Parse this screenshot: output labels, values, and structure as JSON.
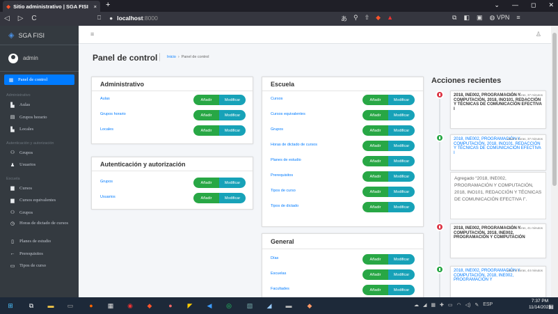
{
  "browser": {
    "tab_title": "Sitio administrativo | SGA FISI",
    "tab_close": "×",
    "new_tab": "+",
    "url_host": "localhost",
    "url_port": ":8000",
    "vpn_label": "VPN",
    "win_min": "—",
    "win_max": "◻",
    "win_close": "✕",
    "nav_back": "◁",
    "nav_forward": "▷",
    "nav_reload": "C"
  },
  "sidebar": {
    "brand": "SGA FISI",
    "user": "admin",
    "active_item": "Panel de control",
    "sections": [
      {
        "title": "Administrativo",
        "items": [
          {
            "label": "Aulas",
            "icon": "building-icon"
          },
          {
            "label": "Grupos horario",
            "icon": "calendar-icon"
          },
          {
            "label": "Locales",
            "icon": "building-icon"
          }
        ]
      },
      {
        "title": "Autenticación y autorización",
        "items": [
          {
            "label": "Grupos",
            "icon": "users-icon"
          },
          {
            "label": "Usuarios",
            "icon": "user-icon"
          }
        ]
      },
      {
        "title": "Escuela",
        "items": [
          {
            "label": "Cursos",
            "icon": "book-icon"
          },
          {
            "label": "Cursos equivalentes",
            "icon": "book-icon"
          },
          {
            "label": "Grupos",
            "icon": "users-icon"
          },
          {
            "label": "Horas de dictado de cursos",
            "icon": "clock-icon"
          },
          {
            "label": "Planes de estudio",
            "icon": "file-icon"
          },
          {
            "label": "Prerequisitos",
            "icon": "arrow-left-icon"
          },
          {
            "label": "Tipos de curso",
            "icon": "monitor-icon"
          }
        ]
      }
    ]
  },
  "header": {
    "title": "Panel de control",
    "breadcrumb": [
      "Inicio",
      "›",
      "Panel de control"
    ]
  },
  "buttons": {
    "add": "Añadir",
    "modify": "Modificar"
  },
  "cards": {
    "administrativo": {
      "title": "Administrativo",
      "rows": [
        "Aulas",
        "Grupos horario",
        "Locales"
      ]
    },
    "auth": {
      "title": "Autenticación y autorización",
      "rows": [
        "Grupos",
        "Usuarios"
      ]
    },
    "escuela": {
      "title": "Escuela",
      "rows": [
        "Cursos",
        "Cursos equivalentes",
        "Grupos",
        "Horas de dictado de cursos",
        "Planes de estudio",
        "Prerequisitos",
        "Tipos de curso",
        "Tipos de dictado"
      ]
    },
    "general": {
      "title": "General",
      "rows": [
        "Días",
        "Escuelas",
        "Facultades"
      ]
    }
  },
  "recent": {
    "title": "Acciones recientes",
    "entries": [
      {
        "type": "delete",
        "time": "Hace 3 horas, 37 minutos",
        "text": "2018, INE002, PROGRAMACIÓN Y COMPUTACIÓN, 2018, INO101, REDACCIÓN Y TÉCNICAS DE COMUNICACIÓN EFECTIVA I"
      },
      {
        "type": "add",
        "time": "Hace 3 horas, 37 minutos",
        "text": "2018, INE002, PROGRAMACIÓN Y COMPUTACIÓN, 2018, INO101, REDACCIÓN Y TÉCNICAS DE COMUNICACIÓN EFECTIVA I",
        "desc": "Agregado “2018, INE002, PROGRAMACIÓN Y COMPUTACIÓN, 2018, INO101, REDACCIÓN Y TÉCNICAS DE COMUNICACIÓN EFECTIVA I”."
      },
      {
        "type": "delete",
        "time": "Hace 3 horas, 41 minutos",
        "text": "2018, INE002, PROGRAMACIÓN Y COMPUTACIÓN, 2018, INE002, PROGRAMACIÓN Y COMPUTACIÓN"
      },
      {
        "type": "add",
        "time": "Hace 3 horas, 44 minutos",
        "text": "2018, INE002, PROGRAMACIÓN Y COMPUTACIÓN, 2018, INE002, PROGRAMACIÓN Y"
      }
    ]
  },
  "taskbar": {
    "lang": "ESP",
    "time": "7:37 PM",
    "date": "11/14/2023"
  },
  "colors": {
    "primary": "#007bff",
    "success": "#28a745",
    "info": "#17a2b8",
    "danger": "#dc3545",
    "sidebar": "#343a40"
  }
}
